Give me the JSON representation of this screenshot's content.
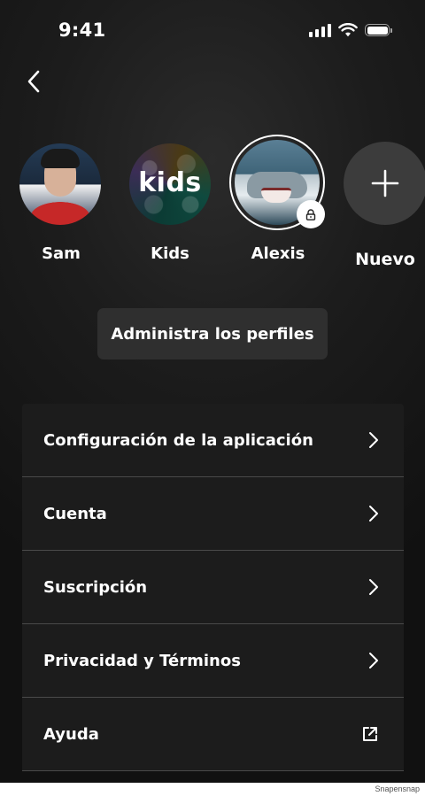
{
  "status_bar": {
    "time": "9:41",
    "icons": [
      "signal-icon",
      "wifi-icon",
      "battery-icon"
    ]
  },
  "nav": {
    "back_icon": "chevron-left-icon"
  },
  "profiles": [
    {
      "name": "Sam",
      "avatar": "photo"
    },
    {
      "name": "Kids",
      "avatar_text": "kids"
    },
    {
      "name": "Alexis",
      "avatar": "shark-photo",
      "selected": true,
      "badge_icon": "lock-icon"
    },
    {
      "name": "Nuevo",
      "icon": "plus-icon"
    }
  ],
  "manage_profiles": {
    "label": "Administra los perfiles"
  },
  "menu": {
    "items": [
      {
        "label": "Configuración de la aplicación",
        "icon": "chevron-right-icon"
      },
      {
        "label": "Cuenta",
        "icon": "chevron-right-icon"
      },
      {
        "label": "Suscripción",
        "icon": "chevron-right-icon"
      },
      {
        "label": "Privacidad y Términos",
        "icon": "chevron-right-icon"
      },
      {
        "label": "Ayuda",
        "icon": "external-link-icon"
      }
    ]
  },
  "watermark": "Snapensnap",
  "colors": {
    "background": "#1a1a1a",
    "surface": "#1c1c1c",
    "button": "#2f2f2f",
    "divider": "#4a4a4a",
    "text": "#ffffff"
  }
}
